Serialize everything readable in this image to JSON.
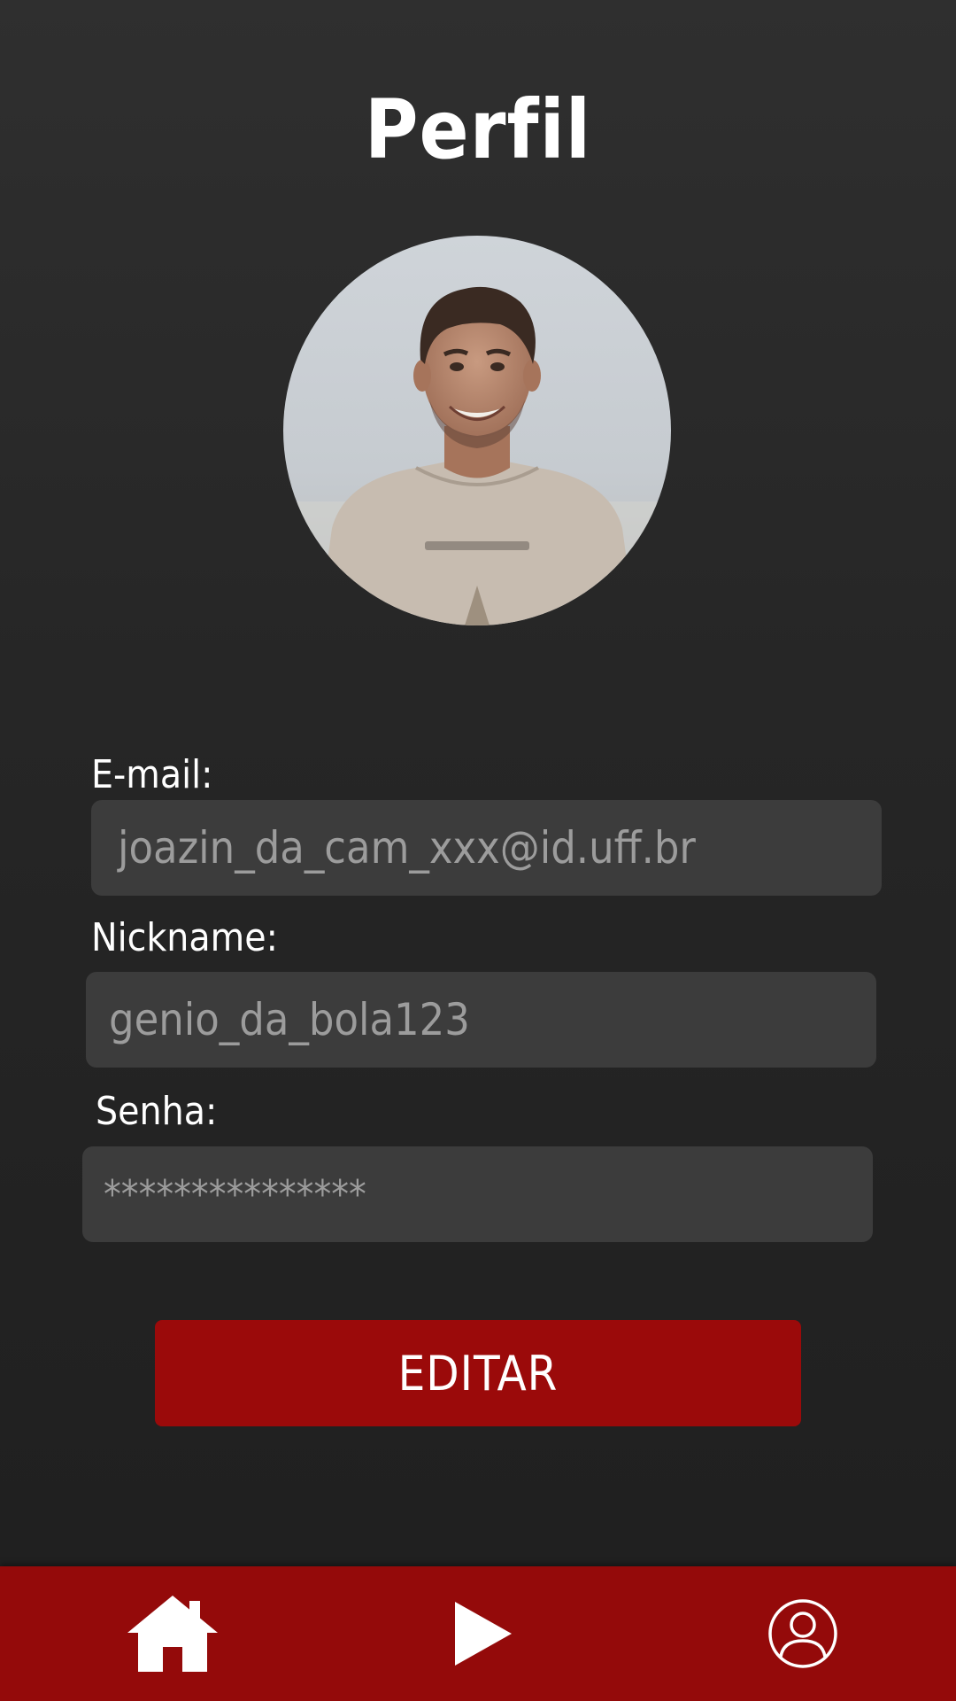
{
  "screen": {
    "title": "Perfil"
  },
  "profile": {
    "avatar_alt": "profile-photo"
  },
  "form": {
    "email_label": "E-mail:",
    "email_value": "joazin_da_cam_xxx@id.uff.br",
    "nickname_label": "Nickname:",
    "nickname_value": "genio_da_bola123",
    "password_label": "Senha:",
    "password_value": "***************"
  },
  "actions": {
    "edit_label": "EDITAR"
  },
  "bottom_nav": {
    "items": [
      {
        "icon": "home-icon"
      },
      {
        "icon": "play-icon"
      },
      {
        "icon": "user-icon"
      }
    ]
  },
  "colors": {
    "accent": "#9b0a0a",
    "nav_background": "#940a0a",
    "field_background": "#3c3c3c",
    "page_background": "#2a2a2a"
  }
}
